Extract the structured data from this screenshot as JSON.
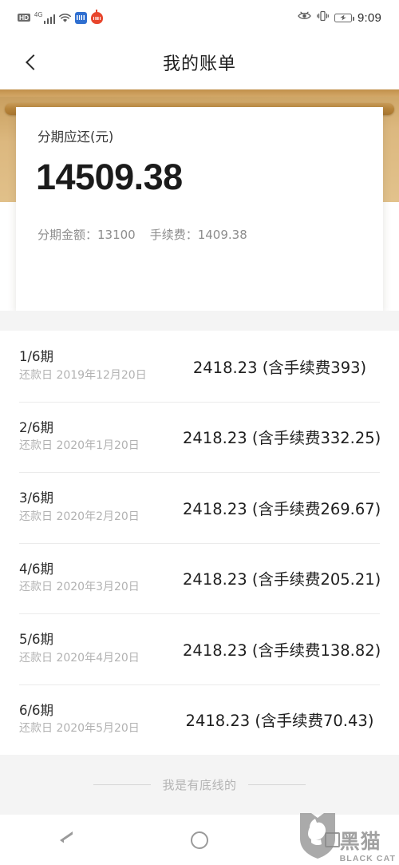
{
  "status_bar": {
    "hd_label": "HD",
    "network_label": "4G",
    "time": "9:09",
    "icons": [
      "hd-icon",
      "signal-bars-icon",
      "wifi-icon",
      "app-blue-icon",
      "app-red-icon",
      "eye-icon",
      "vibrate-icon",
      "battery-charging-icon"
    ]
  },
  "header": {
    "title": "我的账单",
    "back_icon": "chevron-left-icon"
  },
  "summary": {
    "label": "分期应还(元)",
    "amount": "14509.38",
    "principal_label": "分期金额：13100",
    "fee_label": "手续费：1409.38",
    "accent_color": "#d4a868"
  },
  "installments": [
    {
      "term": "1/6期",
      "date": "还款日 2019年12月20日",
      "amount": "2418.23 (含手续费393)"
    },
    {
      "term": "2/6期",
      "date": "还款日 2020年1月20日",
      "amount": "2418.23 (含手续费332.25)"
    },
    {
      "term": "3/6期",
      "date": "还款日 2020年2月20日",
      "amount": "2418.23 (含手续费269.67)"
    },
    {
      "term": "4/6期",
      "date": "还款日 2020年3月20日",
      "amount": "2418.23 (含手续费205.21)"
    },
    {
      "term": "5/6期",
      "date": "还款日 2020年4月20日",
      "amount": "2418.23 (含手续费138.82)"
    },
    {
      "term": "6/6期",
      "date": "还款日 2020年5月20日",
      "amount": "2418.23 (含手续费70.43)"
    }
  ],
  "footer": {
    "end_text": "我是有底线的"
  },
  "nav_bar": {
    "back_icon": "back-triangle-icon",
    "home_icon": "home-circle-icon",
    "recents_icon": "recents-square-icon"
  },
  "watermark": {
    "cn": "黑猫",
    "en": "BLACK CAT",
    "logo_icon": "cat-shield-icon"
  }
}
